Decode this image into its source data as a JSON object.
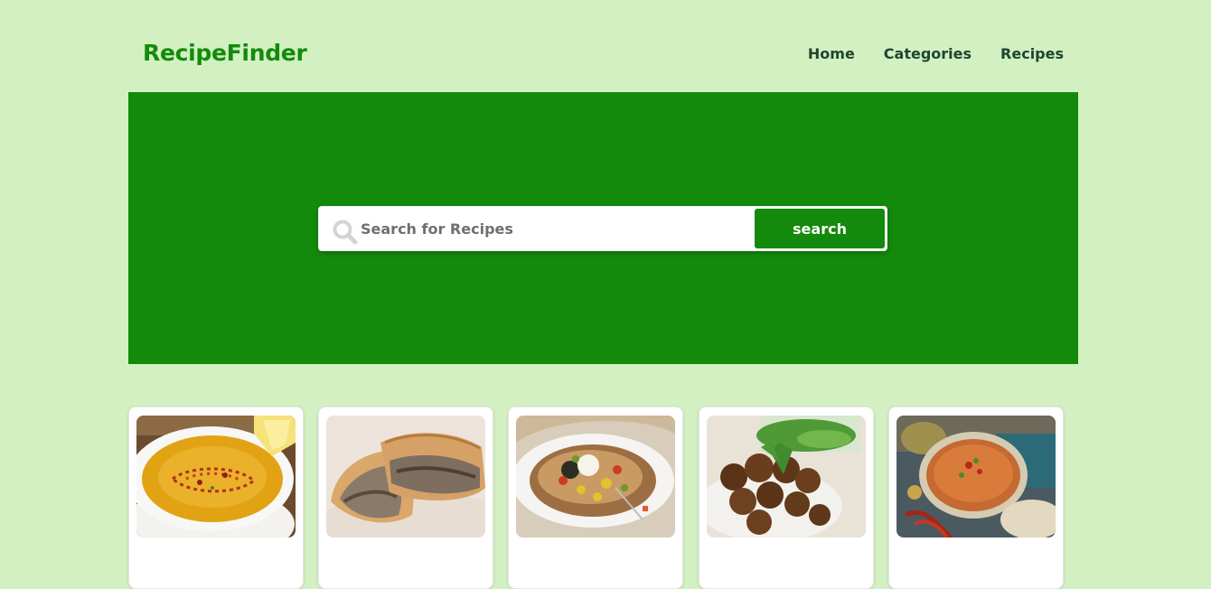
{
  "header": {
    "logo": "RecipeFinder",
    "nav": [
      {
        "label": "Home"
      },
      {
        "label": "Categories"
      },
      {
        "label": "Recipes"
      }
    ]
  },
  "search": {
    "placeholder": "Search for Recipes",
    "value": "",
    "button_label": "search"
  },
  "recipes": [
    {
      "image": "lentil-soup-image"
    },
    {
      "image": "meat-pastry-image"
    },
    {
      "image": "stuffed-potato-image"
    },
    {
      "image": "falafel-image"
    },
    {
      "image": "tomato-soup-image"
    }
  ],
  "colors": {
    "page_background": "#d2f0c1",
    "brand_green": "#138a0b",
    "nav_text": "#1e4530",
    "card_background": "#ffffff"
  }
}
